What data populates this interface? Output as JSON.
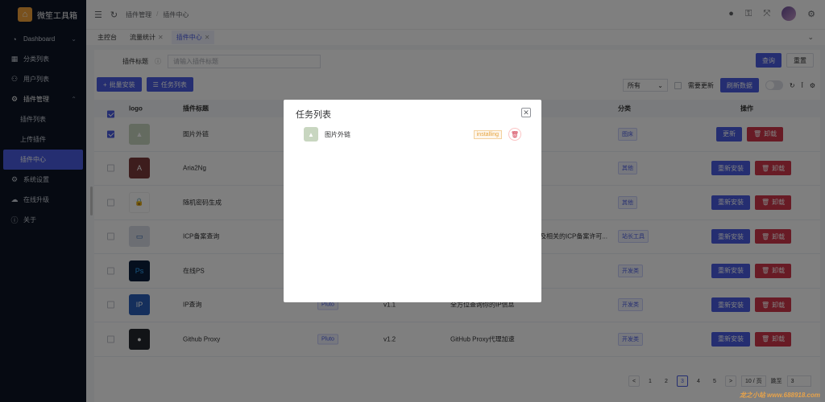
{
  "app": {
    "name": "微笙工具箱"
  },
  "sidebar": {
    "items": [
      {
        "label": "Dashboard",
        "icon": "dashboard-icon"
      },
      {
        "label": "分类列表",
        "icon": "category-icon"
      },
      {
        "label": "用户列表",
        "icon": "users-icon"
      },
      {
        "label": "插件管理",
        "icon": "plugin-icon"
      },
      {
        "label": "插件列表"
      },
      {
        "label": "上传插件"
      },
      {
        "label": "插件中心"
      },
      {
        "label": "系统设置",
        "icon": "gear-icon"
      },
      {
        "label": "在线升级",
        "icon": "cloud-icon"
      },
      {
        "label": "关于",
        "icon": "info-icon"
      }
    ]
  },
  "header": {
    "breadcrumb": [
      "插件管理",
      "插件中心"
    ]
  },
  "tabs": [
    {
      "label": "主控台"
    },
    {
      "label": "流量统计"
    },
    {
      "label": "插件中心"
    }
  ],
  "filter": {
    "label": "插件标题",
    "placeholder": "请输入插件标题",
    "search": "查询",
    "reset": "重置"
  },
  "toolbar": {
    "batch_install": "批量安装",
    "task_list": "任务列表",
    "select_value": "所有",
    "need_update": "需要更新",
    "refresh": "刷新数据"
  },
  "table": {
    "headers": {
      "logo": "logo",
      "title": "插件标题",
      "category": "分类",
      "ops": "操作"
    },
    "rows": [
      {
        "title": "图片外链",
        "category": "图床",
        "checked": true,
        "btn1": "更新",
        "btn2": "卸载"
      },
      {
        "title": "Aria2Ng",
        "category": "其他",
        "checked": false,
        "btn1": "重新安装",
        "btn2": "卸载"
      },
      {
        "title": "随机密码生成",
        "category": "其他",
        "checked": false,
        "btn1": "重新安装",
        "btn2": "卸载"
      },
      {
        "title": "ICP备案查询",
        "category": "站长工具",
        "desc": "及相关的ICP备案许可...",
        "checked": false,
        "btn1": "重新安装",
        "btn2": "卸载"
      },
      {
        "title": "在线PS",
        "category": "开发类",
        "checked": false,
        "btn1": "重新安装",
        "btn2": "卸载"
      },
      {
        "title": "IP查询",
        "category": "开发类",
        "author": "Pluto",
        "version": "v1.1",
        "desc": "全方位查询你的IP信息",
        "checked": false,
        "btn1": "重新安装",
        "btn2": "卸载"
      },
      {
        "title": "Github Proxy",
        "category": "开发类",
        "author": "Pluto",
        "version": "v1.2",
        "desc": "GitHub Proxy代理加速",
        "checked": false,
        "btn1": "重新安装",
        "btn2": "卸载"
      }
    ]
  },
  "pagination": {
    "pages": [
      "1",
      "2",
      "3",
      "4",
      "5"
    ],
    "page_size": "10 / 页",
    "goto_label": "跳至",
    "goto_value": "3",
    "prev": "<",
    "next": ">"
  },
  "dialog": {
    "title": "任务列表",
    "close": "✕",
    "task_name": "图片外链",
    "task_status": "installing"
  },
  "watermark": "龙之小站 www.688918.com",
  "colors": {
    "accent": "#4a5de2",
    "danger": "#d1364b",
    "sidebar": "#0c1524"
  }
}
